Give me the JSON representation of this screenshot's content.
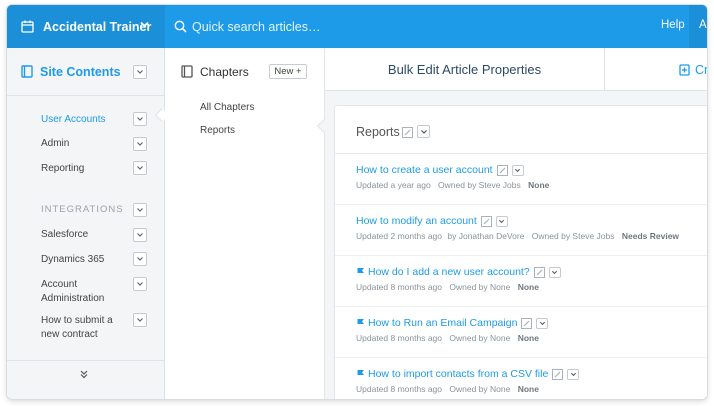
{
  "header": {
    "app_name": "Accidental Trainer",
    "search_placeholder": "Quick search articles…",
    "help_label": "Help",
    "right_label": "Ac"
  },
  "sidebar": {
    "title": "Site Contents",
    "items": [
      {
        "label": "User Accounts",
        "active": true
      },
      {
        "label": "Admin",
        "active": false
      },
      {
        "label": "Reporting",
        "active": false
      }
    ],
    "section_label": "INTEGRATIONS",
    "integration_items": [
      {
        "label": "Salesforce"
      },
      {
        "label": "Dynamics 365"
      },
      {
        "label": "Account Administration"
      },
      {
        "label": "How to submit a new contract"
      }
    ]
  },
  "chapters": {
    "title": "Chapters",
    "new_label": "New +",
    "items": [
      {
        "label": "All Chapters"
      },
      {
        "label": "Reports"
      }
    ]
  },
  "main": {
    "tabs": {
      "bulk_edit": "Bulk Edit Article Properties",
      "create_partial": "Cr"
    },
    "section_title": "Reports",
    "articles": [
      {
        "title": "How to create a user account",
        "flagged": false,
        "updated": "Updated a year ago",
        "by": "",
        "owner": "Owned by Steve Jobs",
        "status": "None"
      },
      {
        "title": "How to modify an account",
        "flagged": false,
        "updated": "Updated 2 months ago",
        "by": "by Jonathan DeVore",
        "owner": "Owned by Steve Jobs",
        "status": "Needs Review"
      },
      {
        "title": "How do I add a new user account?",
        "flagged": true,
        "updated": "Updated 8 months ago",
        "by": "",
        "owner": "Owned by None",
        "status": "None"
      },
      {
        "title": "How to Run an Email Campaign",
        "flagged": true,
        "updated": "Updated 8 months ago",
        "by": "",
        "owner": "Owned by None",
        "status": "None"
      },
      {
        "title": "How to import contacts from a CSV file",
        "flagged": true,
        "updated": "Updated 8 months ago",
        "by": "",
        "owner": "Owned by None",
        "status": "None"
      }
    ]
  },
  "colors": {
    "accent": "#1e9be8",
    "sidebar_bg": "#f3f5f7"
  }
}
